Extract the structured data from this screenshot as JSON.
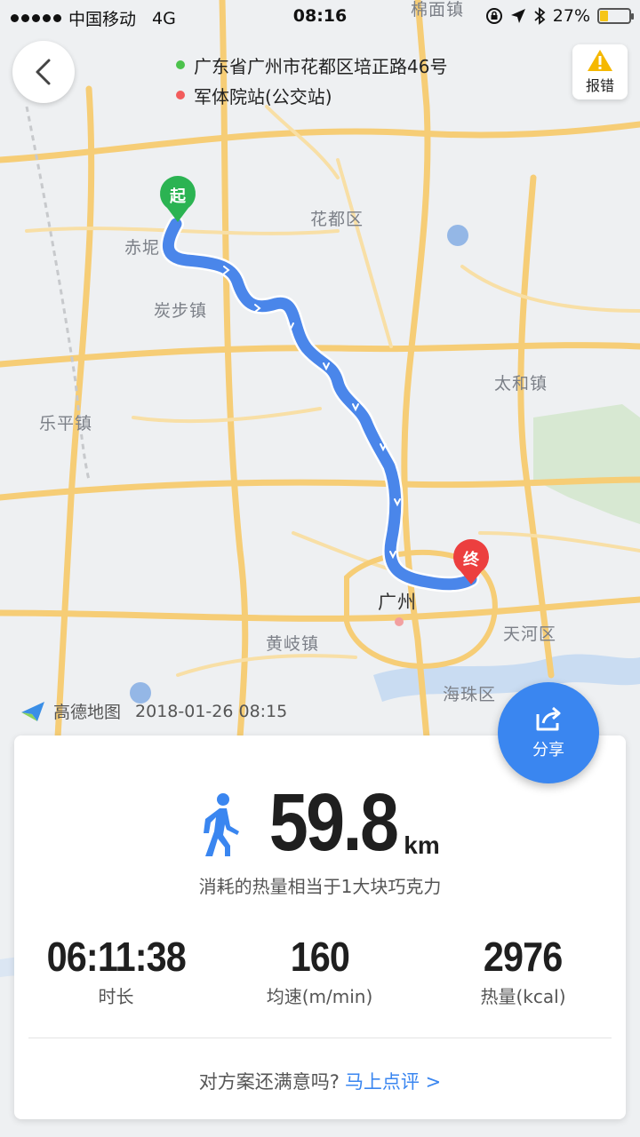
{
  "status_bar": {
    "carrier": "中国移动",
    "network": "4G",
    "time": "08:16",
    "battery_percent": "27%",
    "battery_level": 0.27
  },
  "route": {
    "start_address": "广东省广州市花都区培正路46号",
    "end_address": "军体院站(公交站)",
    "start_color": "#4cc24c",
    "end_color": "#f25c5c"
  },
  "report": {
    "label": "报错"
  },
  "map": {
    "labels": {
      "mianbei": "棉面镇",
      "huadu": "花都区",
      "chini": "赤坭",
      "tanbu": "炭步镇",
      "taihe": "太和镇",
      "leping": "乐平镇",
      "guangzhou": "广州",
      "tianhe": "天河区",
      "huangqi": "黄岐镇",
      "haizhu": "海珠区"
    },
    "start_marker": "起",
    "end_marker": "终",
    "route_color": "#4a86ea",
    "road_color": "#f7cf7a"
  },
  "watermark": {
    "brand": "高德地图",
    "timestamp": "2018-01-26 08:15"
  },
  "share": {
    "label": "分享"
  },
  "summary": {
    "distance": "59.8",
    "distance_unit": "km",
    "calorie_note": "消耗的热量相当于1大块巧克力",
    "stats": [
      {
        "value": "06:11:38",
        "label": "时长"
      },
      {
        "value": "160",
        "label": "均速(m/min)"
      },
      {
        "value": "2976",
        "label": "热量(kcal)"
      }
    ],
    "feedback_question": "对方案还满意吗?",
    "feedback_link": "马上点评 >"
  },
  "colors": {
    "accent": "#3a86f0"
  }
}
